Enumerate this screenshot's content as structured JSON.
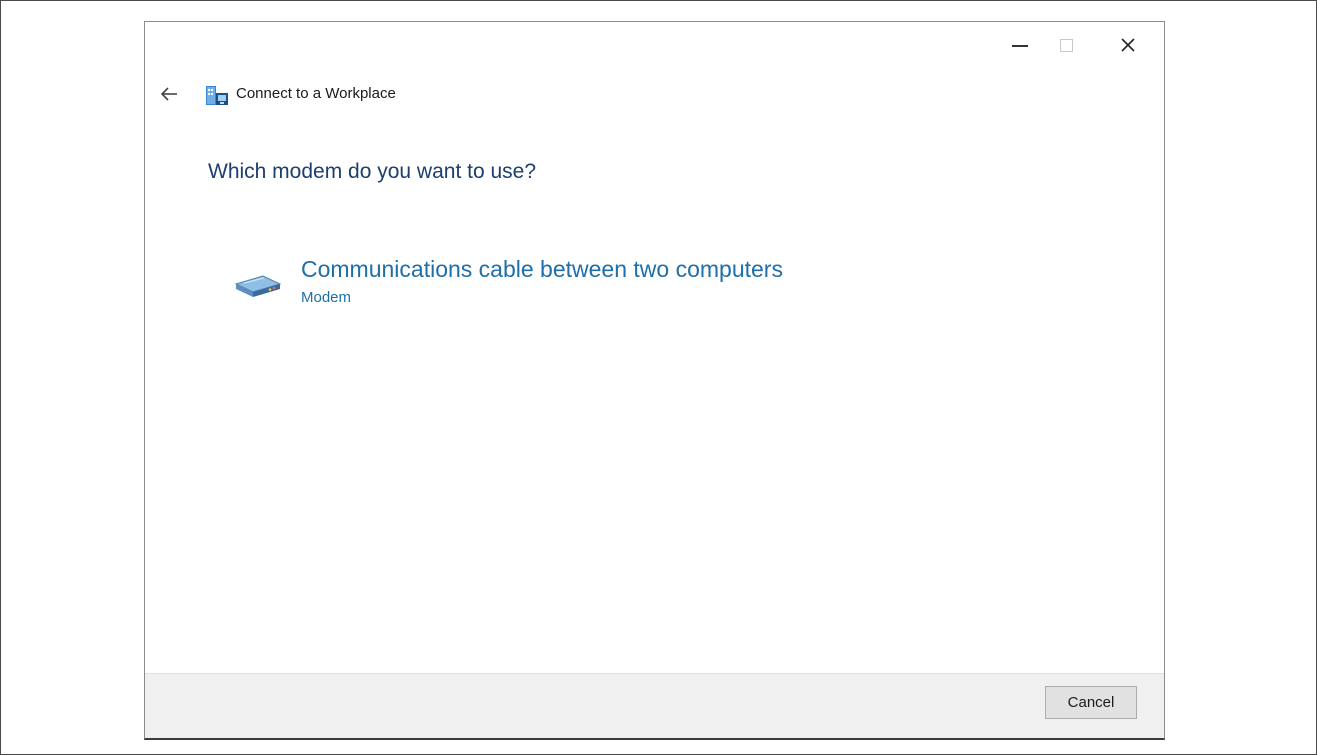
{
  "window": {
    "title": "Connect to a Workplace",
    "controls": {
      "minimize_icon": "minimize-icon",
      "maximize_icon": "maximize-icon",
      "close_icon": "close-icon"
    }
  },
  "header": {
    "back_icon": "back-arrow-icon",
    "app_icon": "workplace-network-icon"
  },
  "main": {
    "question": "Which modem do you want to use?",
    "options": [
      {
        "title": "Communications cable between two computers",
        "subtitle": "Modem",
        "icon": "modem-icon"
      }
    ]
  },
  "footer": {
    "cancel_label": "Cancel"
  },
  "colors": {
    "heading": "#1c3f6e",
    "link": "#1e6fa9",
    "footer_bg": "#f0f0f0"
  }
}
